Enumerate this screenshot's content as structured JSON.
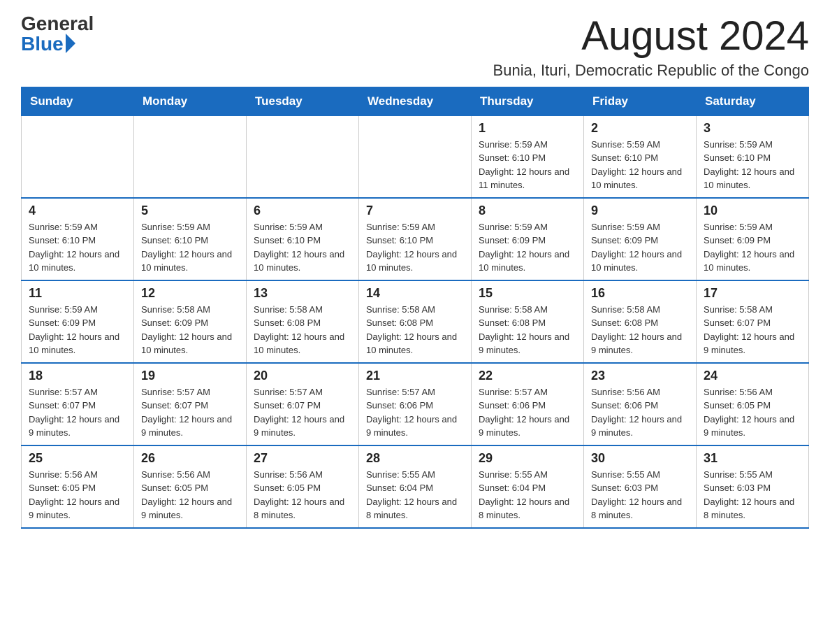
{
  "logo": {
    "general": "General",
    "blue": "Blue"
  },
  "title": "August 2024",
  "location": "Bunia, Ituri, Democratic Republic of the Congo",
  "days_of_week": [
    "Sunday",
    "Monday",
    "Tuesday",
    "Wednesday",
    "Thursday",
    "Friday",
    "Saturday"
  ],
  "weeks": [
    [
      {
        "day": "",
        "info": ""
      },
      {
        "day": "",
        "info": ""
      },
      {
        "day": "",
        "info": ""
      },
      {
        "day": "",
        "info": ""
      },
      {
        "day": "1",
        "info": "Sunrise: 5:59 AM\nSunset: 6:10 PM\nDaylight: 12 hours and 11 minutes."
      },
      {
        "day": "2",
        "info": "Sunrise: 5:59 AM\nSunset: 6:10 PM\nDaylight: 12 hours and 10 minutes."
      },
      {
        "day": "3",
        "info": "Sunrise: 5:59 AM\nSunset: 6:10 PM\nDaylight: 12 hours and 10 minutes."
      }
    ],
    [
      {
        "day": "4",
        "info": "Sunrise: 5:59 AM\nSunset: 6:10 PM\nDaylight: 12 hours and 10 minutes."
      },
      {
        "day": "5",
        "info": "Sunrise: 5:59 AM\nSunset: 6:10 PM\nDaylight: 12 hours and 10 minutes."
      },
      {
        "day": "6",
        "info": "Sunrise: 5:59 AM\nSunset: 6:10 PM\nDaylight: 12 hours and 10 minutes."
      },
      {
        "day": "7",
        "info": "Sunrise: 5:59 AM\nSunset: 6:10 PM\nDaylight: 12 hours and 10 minutes."
      },
      {
        "day": "8",
        "info": "Sunrise: 5:59 AM\nSunset: 6:09 PM\nDaylight: 12 hours and 10 minutes."
      },
      {
        "day": "9",
        "info": "Sunrise: 5:59 AM\nSunset: 6:09 PM\nDaylight: 12 hours and 10 minutes."
      },
      {
        "day": "10",
        "info": "Sunrise: 5:59 AM\nSunset: 6:09 PM\nDaylight: 12 hours and 10 minutes."
      }
    ],
    [
      {
        "day": "11",
        "info": "Sunrise: 5:59 AM\nSunset: 6:09 PM\nDaylight: 12 hours and 10 minutes."
      },
      {
        "day": "12",
        "info": "Sunrise: 5:58 AM\nSunset: 6:09 PM\nDaylight: 12 hours and 10 minutes."
      },
      {
        "day": "13",
        "info": "Sunrise: 5:58 AM\nSunset: 6:08 PM\nDaylight: 12 hours and 10 minutes."
      },
      {
        "day": "14",
        "info": "Sunrise: 5:58 AM\nSunset: 6:08 PM\nDaylight: 12 hours and 10 minutes."
      },
      {
        "day": "15",
        "info": "Sunrise: 5:58 AM\nSunset: 6:08 PM\nDaylight: 12 hours and 9 minutes."
      },
      {
        "day": "16",
        "info": "Sunrise: 5:58 AM\nSunset: 6:08 PM\nDaylight: 12 hours and 9 minutes."
      },
      {
        "day": "17",
        "info": "Sunrise: 5:58 AM\nSunset: 6:07 PM\nDaylight: 12 hours and 9 minutes."
      }
    ],
    [
      {
        "day": "18",
        "info": "Sunrise: 5:57 AM\nSunset: 6:07 PM\nDaylight: 12 hours and 9 minutes."
      },
      {
        "day": "19",
        "info": "Sunrise: 5:57 AM\nSunset: 6:07 PM\nDaylight: 12 hours and 9 minutes."
      },
      {
        "day": "20",
        "info": "Sunrise: 5:57 AM\nSunset: 6:07 PM\nDaylight: 12 hours and 9 minutes."
      },
      {
        "day": "21",
        "info": "Sunrise: 5:57 AM\nSunset: 6:06 PM\nDaylight: 12 hours and 9 minutes."
      },
      {
        "day": "22",
        "info": "Sunrise: 5:57 AM\nSunset: 6:06 PM\nDaylight: 12 hours and 9 minutes."
      },
      {
        "day": "23",
        "info": "Sunrise: 5:56 AM\nSunset: 6:06 PM\nDaylight: 12 hours and 9 minutes."
      },
      {
        "day": "24",
        "info": "Sunrise: 5:56 AM\nSunset: 6:05 PM\nDaylight: 12 hours and 9 minutes."
      }
    ],
    [
      {
        "day": "25",
        "info": "Sunrise: 5:56 AM\nSunset: 6:05 PM\nDaylight: 12 hours and 9 minutes."
      },
      {
        "day": "26",
        "info": "Sunrise: 5:56 AM\nSunset: 6:05 PM\nDaylight: 12 hours and 9 minutes."
      },
      {
        "day": "27",
        "info": "Sunrise: 5:56 AM\nSunset: 6:05 PM\nDaylight: 12 hours and 8 minutes."
      },
      {
        "day": "28",
        "info": "Sunrise: 5:55 AM\nSunset: 6:04 PM\nDaylight: 12 hours and 8 minutes."
      },
      {
        "day": "29",
        "info": "Sunrise: 5:55 AM\nSunset: 6:04 PM\nDaylight: 12 hours and 8 minutes."
      },
      {
        "day": "30",
        "info": "Sunrise: 5:55 AM\nSunset: 6:03 PM\nDaylight: 12 hours and 8 minutes."
      },
      {
        "day": "31",
        "info": "Sunrise: 5:55 AM\nSunset: 6:03 PM\nDaylight: 12 hours and 8 minutes."
      }
    ]
  ]
}
